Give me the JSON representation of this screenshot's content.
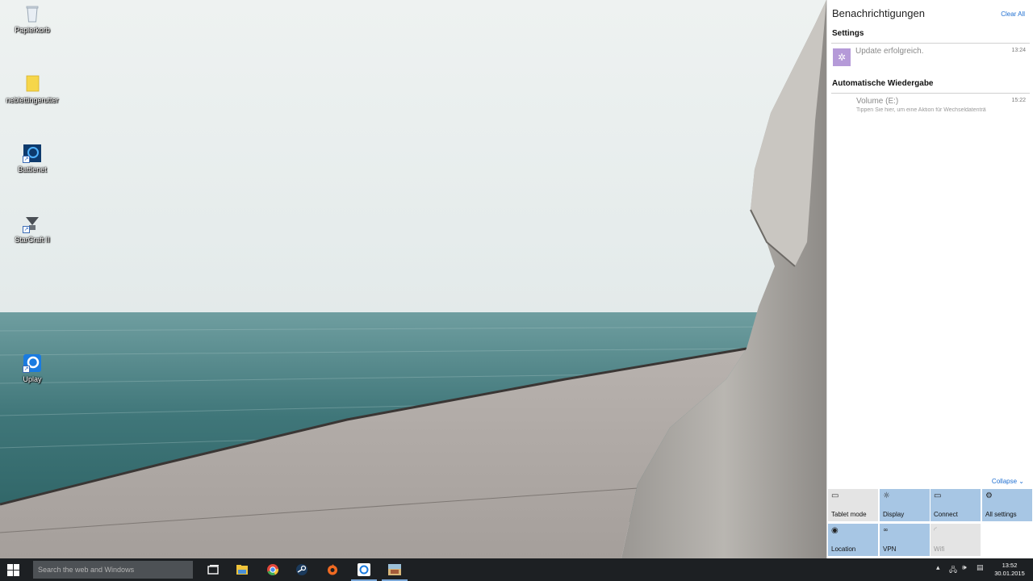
{
  "desktop": {
    "icons": [
      {
        "name": "recycle-bin",
        "label": "Papierkorb"
      },
      {
        "name": "folder",
        "label": "neblettingerutter"
      },
      {
        "name": "battlenet",
        "label": "Battlenet"
      },
      {
        "name": "starcraft",
        "label": "StarCraft II"
      },
      {
        "name": "uplay",
        "label": "Uplay"
      }
    ]
  },
  "action_center": {
    "title": "Benachrichtigungen",
    "clear_all": "Clear All",
    "groups": [
      {
        "title": "Settings",
        "notifications": [
          {
            "icon": "gear-icon",
            "title": "Update erfolgreich.",
            "body": "",
            "time": "13:24"
          }
        ]
      },
      {
        "title": "Automatische Wiedergabe",
        "notifications": [
          {
            "icon": "",
            "title": "Volume (E:)",
            "body": "Tippen Sie hier, um eine Aktion für Wechseldatenträ",
            "time": "15:22"
          }
        ]
      }
    ],
    "collapse": "Collapse",
    "quick_actions": [
      {
        "label": "Tablet mode",
        "icon": "tablet-mode-icon",
        "on": false
      },
      {
        "label": "Display",
        "icon": "brightness-icon",
        "on": true
      },
      {
        "label": "Connect",
        "icon": "connect-icon",
        "on": true
      },
      {
        "label": "All settings",
        "icon": "gear-icon",
        "on": true
      },
      {
        "label": "Location",
        "icon": "location-icon",
        "on": true
      },
      {
        "label": "VPN",
        "icon": "vpn-icon",
        "on": true
      },
      {
        "label": "Wifi",
        "icon": "wifi-icon",
        "on": false
      }
    ]
  },
  "taskbar": {
    "search_placeholder": "Search the web and Windows",
    "apps": [
      "task-view",
      "file-explorer",
      "chrome",
      "steam",
      "origin",
      "uplay",
      "photos"
    ],
    "clock": {
      "time": "13:52",
      "date": "30.01.2015"
    }
  },
  "colors": {
    "taskbar_bg": "#1d2023",
    "tile_on": "#a7c6e4",
    "tile_off": "#e4e4e4",
    "link": "#1f6fd1",
    "settings_badge": "#b59ad8"
  }
}
